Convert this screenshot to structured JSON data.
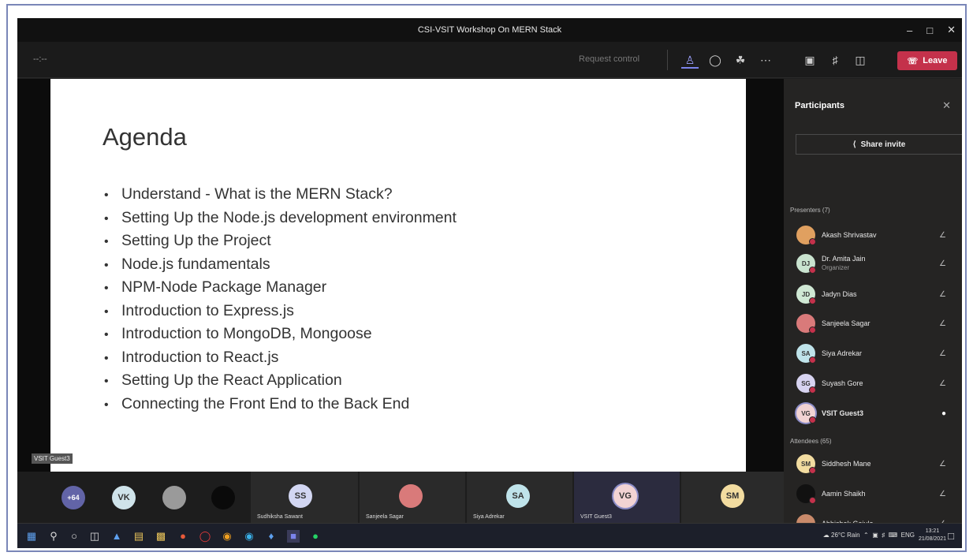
{
  "window": {
    "title": "CSI-VSIT Workshop On MERN Stack"
  },
  "toolbar": {
    "timer": "--:--",
    "request_control": "Request control",
    "leave_label": "Leave"
  },
  "slide": {
    "title": "Agenda",
    "items": [
      "Understand - What is the MERN Stack?",
      "Setting Up the Node.js development environment",
      "Setting Up the Project",
      "Node.js fundamentals",
      "NPM-Node Package Manager",
      "Introduction to Express.js",
      "Introduction to MongoDB, Mongoose",
      "Introduction to React.js",
      "Setting Up the React Application",
      "Connecting the Front End to the Back End"
    ]
  },
  "stage_tag": "VSIT Guest3",
  "panel": {
    "title": "Participants",
    "share_label": "Share invite",
    "presenters_label": "Presenters (7)",
    "attendees_label": "Attendees (65)",
    "presenters": [
      {
        "name": "Akash Shrivastav",
        "initials": "",
        "color": "#e0a060"
      },
      {
        "name": "Dr. Amita Jain",
        "role": "Organizer",
        "initials": "DJ",
        "color": "#c9e3cf"
      },
      {
        "name": "Jadyn Dias",
        "initials": "JD",
        "color": "#cfe8d4"
      },
      {
        "name": "Sanjeela Sagar",
        "initials": "",
        "color": "#d97a7a"
      },
      {
        "name": "Siya Adrekar",
        "initials": "SA",
        "color": "#bfe3ea"
      },
      {
        "name": "Suyash Gore",
        "initials": "SG",
        "color": "#d7d3f0"
      },
      {
        "name": "VSIT Guest3",
        "initials": "VG",
        "color": "#f2d3d3"
      }
    ],
    "attendees": [
      {
        "name": "Siddhesh Mane",
        "initials": "SM",
        "color": "#f2dca0"
      },
      {
        "name": "Aamin Shaikh",
        "initials": "",
        "color": "#111111"
      },
      {
        "name": "Abhishek Gajula",
        "initials": "",
        "color": "#c98a6a"
      }
    ]
  },
  "strip": {
    "overflow": "+64",
    "tiles": [
      {
        "initials": "VK",
        "label": "",
        "color": "#cfe3ea"
      },
      {
        "initials": "",
        "label": "",
        "color": "#9a9a9a"
      },
      {
        "initials": "",
        "label": "",
        "color": "#0a0a0a"
      },
      {
        "initials": "SS",
        "label": "Sudhiksha Sawant",
        "color": "#d2d6f2"
      },
      {
        "initials": "",
        "label": "Sanjeela Sagar",
        "color": "#d97a7a"
      },
      {
        "initials": "SA",
        "label": "Siya Adrekar",
        "color": "#bfe3ea"
      },
      {
        "initials": "VG",
        "label": "VSIT Guest3",
        "color": "#f2d3d3"
      },
      {
        "initials": "SM",
        "label": "",
        "color": "#f2dca0"
      }
    ]
  },
  "taskbar": {
    "weather": "26°C Rain",
    "lang": "ENG",
    "time": "13:21",
    "date": "21/08/2021"
  }
}
